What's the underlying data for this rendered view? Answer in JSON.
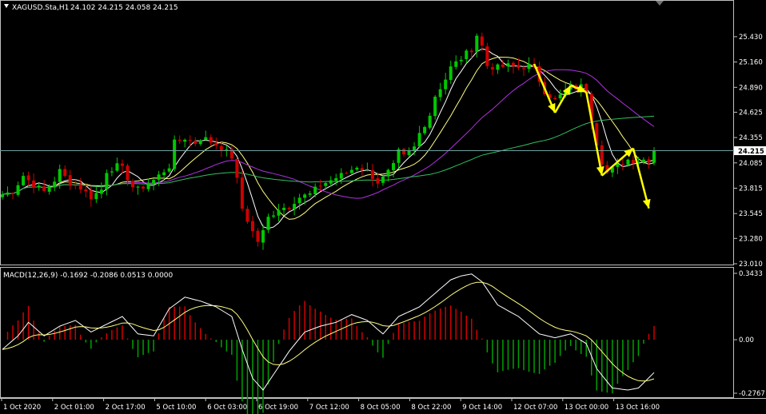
{
  "window": {
    "symbol_title": "XAGUSD.Sta,H1",
    "ohlc": "24.102 24.215 24.058 24.215"
  },
  "macd": {
    "label": "MACD(12,26,9) -0.1692 -0.2086 0.0513 0.0000",
    "axis": [
      "0.3433",
      "0.00",
      "-0.2767"
    ]
  },
  "price_axis": [
    "25.430",
    "25.160",
    "24.890",
    "24.625",
    "24.355",
    "24.085",
    "23.815",
    "23.545",
    "23.280",
    "23.010"
  ],
  "current_price": "24.215",
  "time_axis": [
    "1 Oct 2020",
    "2 Oct 01:00",
    "2 Oct 17:00",
    "5 Oct 10:00",
    "6 Oct 03:00",
    "6 Oct 19:00",
    "7 Oct 12:00",
    "8 Oct 05:00",
    "8 Oct 22:00",
    "9 Oct 14:00",
    "12 Oct 07:00",
    "13 Oct 00:00",
    "13 Oct 16:00"
  ],
  "colors": {
    "background": "#000000",
    "bull_candle": "#00c800",
    "bear_candle": "#d00000",
    "ma_fast": "#ffffff",
    "ma_mid": "#ffff80",
    "ma_slow_violet": "#b030e0",
    "ma_long_green": "#30c060",
    "annotation_arrows": "#ffff00",
    "current_price_line": "#6fa0a0",
    "macd_pos": "#d00000",
    "macd_neg": "#00a000"
  },
  "chart_data": {
    "type": "candlestick",
    "symbol": "XAGUSD.Sta",
    "timeframe": "H1",
    "ylim": [
      23.01,
      25.54
    ],
    "price_path": [
      [
        0,
        23.75
      ],
      [
        2,
        23.78
      ],
      [
        4,
        23.95
      ],
      [
        6,
        23.85
      ],
      [
        8,
        23.78
      ],
      [
        10,
        23.9
      ],
      [
        11,
        24.0
      ],
      [
        13,
        23.87
      ],
      [
        15,
        23.82
      ],
      [
        17,
        23.72
      ],
      [
        19,
        23.8
      ],
      [
        20,
        24.0
      ],
      [
        22,
        24.05
      ],
      [
        23,
        24.02
      ],
      [
        25,
        23.83
      ],
      [
        26,
        23.8
      ],
      [
        29,
        23.9
      ],
      [
        32,
        24.05
      ],
      [
        33,
        24.3
      ],
      [
        35,
        24.35
      ],
      [
        37,
        24.3
      ],
      [
        38,
        24.35
      ],
      [
        39,
        24.34
      ],
      [
        42,
        24.25
      ],
      [
        44,
        24.15
      ],
      [
        45,
        23.9
      ],
      [
        46,
        23.6
      ],
      [
        48,
        23.35
      ],
      [
        49,
        23.25
      ],
      [
        50,
        23.35
      ],
      [
        51,
        23.5
      ],
      [
        53,
        23.6
      ],
      [
        55,
        23.62
      ],
      [
        56,
        23.68
      ],
      [
        57,
        23.72
      ],
      [
        59,
        23.75
      ],
      [
        61,
        23.85
      ],
      [
        63,
        23.9
      ],
      [
        66,
        23.98
      ],
      [
        68,
        24.05
      ],
      [
        70,
        24.0
      ],
      [
        72,
        23.88
      ],
      [
        73,
        23.92
      ],
      [
        75,
        24.05
      ],
      [
        76,
        24.2
      ],
      [
        77,
        24.15
      ],
      [
        79,
        24.25
      ],
      [
        80,
        24.4
      ],
      [
        82,
        24.6
      ],
      [
        83,
        24.8
      ],
      [
        85,
        24.98
      ],
      [
        86,
        25.1
      ],
      [
        88,
        25.2
      ],
      [
        90,
        25.3
      ],
      [
        91,
        25.45
      ],
      [
        92,
        25.33
      ],
      [
        93,
        25.12
      ],
      [
        95,
        25.1
      ],
      [
        97,
        25.12
      ],
      [
        99,
        25.1
      ],
      [
        101,
        25.12
      ],
      [
        102,
        25.08
      ],
      [
        104,
        24.85
      ],
      [
        106,
        24.75
      ],
      [
        108,
        24.85
      ],
      [
        109,
        24.88
      ],
      [
        111,
        24.9
      ],
      [
        112,
        24.85
      ],
      [
        113,
        24.55
      ],
      [
        114,
        24.3
      ],
      [
        115,
        24.1
      ],
      [
        116,
        23.98
      ],
      [
        118,
        24.05
      ],
      [
        120,
        24.12
      ],
      [
        122,
        24.1
      ],
      [
        123,
        24.12
      ],
      [
        124,
        24.12
      ],
      [
        125,
        24.215
      ]
    ],
    "macd_path": [
      [
        0,
        -0.05
      ],
      [
        3,
        0.02
      ],
      [
        5,
        0.09
      ],
      [
        8,
        0.02
      ],
      [
        11,
        0.07
      ],
      [
        14,
        0.1
      ],
      [
        17,
        0.04
      ],
      [
        20,
        0.08
      ],
      [
        23,
        0.12
      ],
      [
        26,
        0.03
      ],
      [
        29,
        0.02
      ],
      [
        32,
        0.16
      ],
      [
        35,
        0.22
      ],
      [
        38,
        0.2
      ],
      [
        41,
        0.17
      ],
      [
        44,
        0.12
      ],
      [
        46,
        -0.05
      ],
      [
        48,
        -0.2
      ],
      [
        50,
        -0.26
      ],
      [
        52,
        -0.18
      ],
      [
        55,
        -0.06
      ],
      [
        58,
        0.04
      ],
      [
        61,
        0.07
      ],
      [
        64,
        0.09
      ],
      [
        67,
        0.13
      ],
      [
        70,
        0.1
      ],
      [
        73,
        0.03
      ],
      [
        76,
        0.12
      ],
      [
        80,
        0.17
      ],
      [
        83,
        0.24
      ],
      [
        86,
        0.31
      ],
      [
        88,
        0.33
      ],
      [
        90,
        0.34
      ],
      [
        92,
        0.3
      ],
      [
        95,
        0.18
      ],
      [
        99,
        0.12
      ],
      [
        103,
        0.03
      ],
      [
        106,
        0.01
      ],
      [
        109,
        0.03
      ],
      [
        112,
        -0.02
      ],
      [
        114,
        -0.15
      ],
      [
        117,
        -0.25
      ],
      [
        120,
        -0.26
      ],
      [
        122,
        -0.25
      ],
      [
        125,
        -0.17
      ]
    ],
    "signal_smoothing": 9,
    "moving_averages": [
      {
        "period": 5
      },
      {
        "period": 10
      },
      {
        "period": 24
      },
      {
        "period": 60
      }
    ],
    "annotations": {
      "zigzag": [
        [
          102,
          25.14
        ],
        [
          106,
          24.62
        ],
        [
          109,
          24.91
        ],
        [
          112,
          24.84
        ],
        [
          115,
          23.95
        ],
        [
          121,
          24.24
        ],
        [
          124,
          23.6
        ]
      ]
    }
  }
}
